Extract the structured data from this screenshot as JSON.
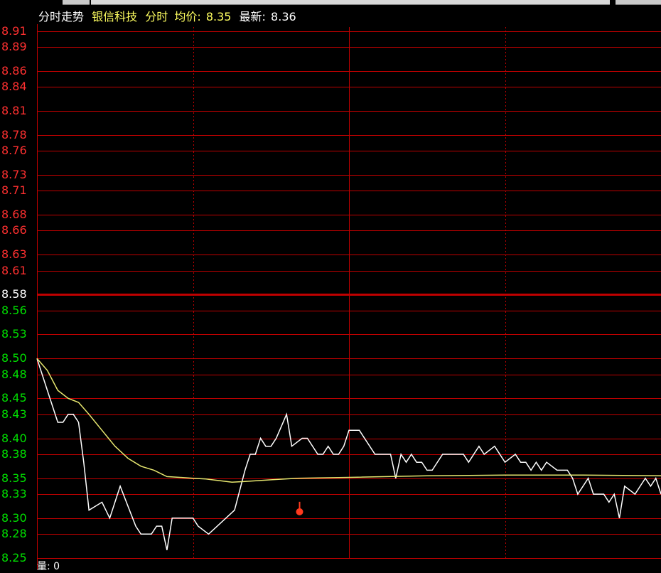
{
  "window": {
    "toolbar_text": "",
    "toolbar_right": ""
  },
  "header": {
    "view_label": "分时走势",
    "stock_name": "银信科技",
    "mode": "分时",
    "avg_label": "均价:",
    "avg_value": "8.35",
    "latest_label": "最新:",
    "latest_value": "8.36"
  },
  "footer": {
    "volume_label": "量: 0"
  },
  "colors": {
    "background": "#000000",
    "grid": "#c00000",
    "price_line": "#ffffff",
    "avg_line": "#e8e870",
    "up_text": "#ff3030",
    "down_text": "#00e000",
    "ref_text": "#ffffff",
    "marker": "#ff3a1e"
  },
  "chart_data": {
    "type": "line",
    "title": "",
    "xlabel": "",
    "ylabel": "",
    "ylim": [
      8.25,
      8.915
    ],
    "reference_price": 8.58,
    "y_ticks": [
      "8.91",
      "8.89",
      "8.86",
      "8.84",
      "8.81",
      "8.78",
      "8.76",
      "8.73",
      "8.71",
      "8.68",
      "8.66",
      "8.63",
      "8.61",
      "8.58",
      "8.56",
      "8.53",
      "8.50",
      "8.48",
      "8.45",
      "8.43",
      "8.40",
      "8.38",
      "8.35",
      "8.33",
      "8.30",
      "8.28",
      "8.25"
    ],
    "y_tick_values": [
      8.91,
      8.89,
      8.86,
      8.84,
      8.81,
      8.78,
      8.76,
      8.73,
      8.71,
      8.68,
      8.66,
      8.63,
      8.61,
      8.58,
      8.56,
      8.53,
      8.5,
      8.48,
      8.45,
      8.43,
      8.4,
      8.38,
      8.35,
      8.33,
      8.3,
      8.28,
      8.25
    ],
    "x_ticks_count": 240,
    "marker": {
      "x": 101,
      "y": 8.308
    },
    "series": [
      {
        "role": "price",
        "x": [
          0,
          4,
          8,
          10,
          12,
          14,
          16,
          18,
          20,
          25,
          28,
          32,
          38,
          40,
          42,
          44,
          46,
          48,
          50,
          52,
          54,
          56,
          60,
          62,
          66,
          76,
          80,
          82,
          84,
          86,
          88,
          90,
          92,
          96,
          98,
          102,
          104,
          108,
          110,
          112,
          114,
          116,
          118,
          120,
          124,
          130,
          133,
          136,
          138,
          140,
          142,
          144,
          146,
          148,
          150,
          152,
          156,
          160,
          164,
          166,
          170,
          172,
          176,
          180,
          184,
          186,
          188,
          190,
          192,
          194,
          196,
          200,
          204,
          206,
          208,
          212,
          214,
          216,
          218,
          220,
          222,
          224,
          226,
          230,
          232,
          234,
          236,
          238,
          240
        ],
        "values": [
          8.5,
          8.46,
          8.42,
          8.42,
          8.43,
          8.43,
          8.42,
          8.37,
          8.31,
          8.32,
          8.3,
          8.34,
          8.29,
          8.28,
          8.28,
          8.28,
          8.29,
          8.29,
          8.26,
          8.3,
          8.3,
          8.3,
          8.3,
          8.29,
          8.28,
          8.31,
          8.36,
          8.38,
          8.38,
          8.4,
          8.39,
          8.39,
          8.4,
          8.43,
          8.39,
          8.4,
          8.4,
          8.38,
          8.38,
          8.39,
          8.38,
          8.38,
          8.39,
          8.41,
          8.41,
          8.38,
          8.38,
          8.38,
          8.35,
          8.38,
          8.37,
          8.38,
          8.37,
          8.37,
          8.36,
          8.36,
          8.38,
          8.38,
          8.38,
          8.37,
          8.39,
          8.38,
          8.39,
          8.37,
          8.38,
          8.37,
          8.37,
          8.36,
          8.37,
          8.36,
          8.37,
          8.36,
          8.36,
          8.35,
          8.33,
          8.35,
          8.33,
          8.33,
          8.33,
          8.32,
          8.33,
          8.3,
          8.34,
          8.33,
          8.34,
          8.35,
          8.34,
          8.35,
          8.33
        ]
      },
      {
        "role": "average",
        "x": [
          0,
          4,
          8,
          12,
          16,
          20,
          25,
          30,
          35,
          40,
          45,
          50,
          55,
          60,
          65,
          70,
          75,
          80,
          90,
          100,
          120,
          150,
          180,
          210,
          240
        ],
        "values": [
          8.5,
          8.485,
          8.46,
          8.45,
          8.445,
          8.43,
          8.41,
          8.39,
          8.375,
          8.365,
          8.36,
          8.352,
          8.351,
          8.35,
          8.349,
          8.347,
          8.345,
          8.346,
          8.348,
          8.35,
          8.351,
          8.353,
          8.354,
          8.354,
          8.353
        ]
      }
    ]
  }
}
